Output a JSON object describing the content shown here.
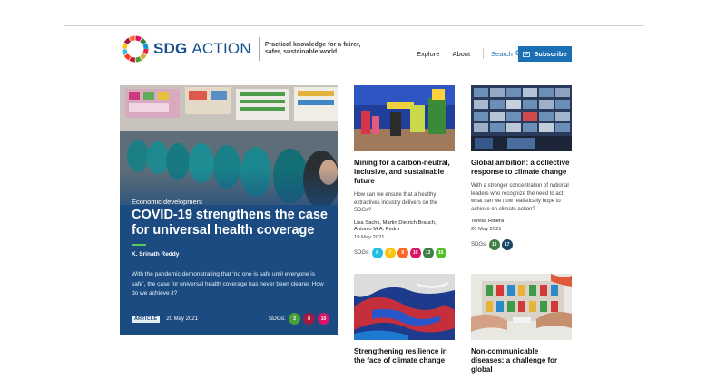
{
  "header": {
    "brand_main": "SDG",
    "brand_light": "ACTION",
    "tagline_line1": "Practical knowledge for a fairer,",
    "tagline_line2": "safer, sustainable world",
    "nav": {
      "explore": "Explore",
      "about": "About",
      "search": "Search"
    },
    "subscribe": "Subscribe"
  },
  "hero": {
    "category": "Economic development",
    "title": "COVID-19 strengthens the case for universal health coverage",
    "author": "K. Srinath Reddy",
    "description": "With the pandemic demonstrating that ‘no one is safe until everyone is safe’, the case for universal health coverage has never been clearer. How do we achieve it?",
    "badge": "ARTICLE",
    "date": "20 May 2021",
    "sdgs_label": "SDGs:",
    "sdgs": [
      {
        "num": "3",
        "color": "#4c9f38"
      },
      {
        "num": "8",
        "color": "#a21942"
      },
      {
        "num": "10",
        "color": "#dd1367"
      }
    ]
  },
  "cards": [
    {
      "title": "Mining for a carbon-neutral, inclusive, and sustainable future",
      "description": "How can we ensure that a healthy extractives industry delivers on the SDGs?",
      "author": "Lisa Sachs, Martin Dietrich Brauch, Antonio M.A. Pedro",
      "date": "19 May 2021",
      "sdgs_label": "SDGs:",
      "sdgs": [
        {
          "num": "6",
          "color": "#26bde2"
        },
        {
          "num": "7",
          "color": "#fcc30b"
        },
        {
          "num": "9",
          "color": "#fd6925"
        },
        {
          "num": "10",
          "color": "#dd1367"
        },
        {
          "num": "13",
          "color": "#3f7e44"
        },
        {
          "num": "15",
          "color": "#56c02b"
        }
      ]
    },
    {
      "title": "Global ambition: a collective response to climate change",
      "description": "With a stronger concentration of national leaders who recognize the need to act, what can we now realistically hope to achieve on climate action?",
      "author": "Teresa Ribera",
      "date": "20 May 2021",
      "sdgs_label": "SDGs:",
      "sdgs": [
        {
          "num": "13",
          "color": "#3f7e44"
        },
        {
          "num": "17",
          "color": "#19486a"
        }
      ]
    },
    {
      "title": "Strengthening resilience in the face of climate change"
    },
    {
      "title": "Non-communicable diseases: a challenge for global"
    }
  ],
  "colors": {
    "brand": "#17508e",
    "accent": "#1b6fb5",
    "hero_bg": "#1b4b80",
    "hero_rule": "#5cc85a"
  }
}
